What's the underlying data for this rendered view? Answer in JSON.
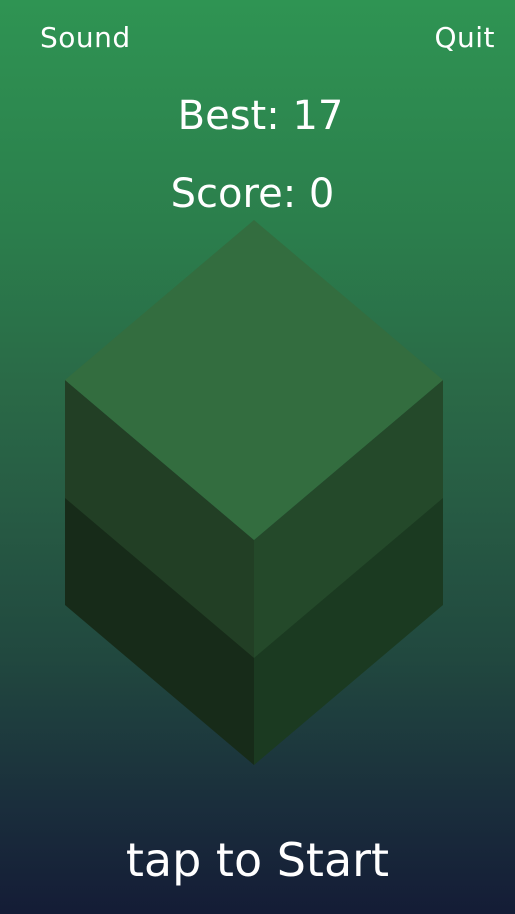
{
  "header": {
    "sound_label": "Sound",
    "quit_label": "Quit"
  },
  "scoreboard": {
    "best_label": "Best:",
    "best_value": "17",
    "score_label": "Score:",
    "score_value": "0"
  },
  "prompt": {
    "start_label": "tap to Start"
  },
  "colors": {
    "top_face": "#336d3f",
    "upper_left_face": "#223f25",
    "upper_right_face": "#24492a",
    "lower_left_face": "#172b19",
    "lower_right_face": "#1b3a21",
    "text": "#ffffff"
  }
}
